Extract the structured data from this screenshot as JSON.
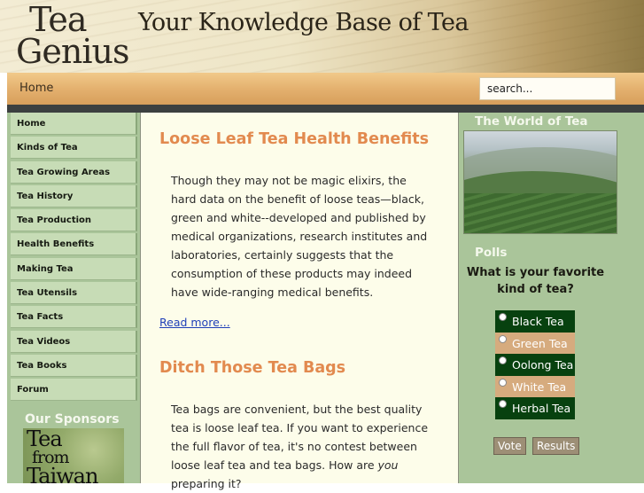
{
  "header": {
    "logo_line1": "Tea",
    "logo_line2": "Genius",
    "tagline": "Your Knowledge Base of Tea"
  },
  "nav": {
    "home_label": "Home",
    "search_value": "search..."
  },
  "sidebar": {
    "items": [
      {
        "label": "Home"
      },
      {
        "label": "Kinds of Tea"
      },
      {
        "label": "Tea Growing Areas"
      },
      {
        "label": "Tea History"
      },
      {
        "label": "Tea Production"
      },
      {
        "label": "Health Benefits"
      },
      {
        "label": "Making Tea"
      },
      {
        "label": "Tea Utensils"
      },
      {
        "label": "Tea Facts"
      },
      {
        "label": "Tea Videos"
      },
      {
        "label": "Tea Books"
      },
      {
        "label": "Forum"
      }
    ],
    "sponsors_title": "Our Sponsors",
    "sponsor_text_1": "Tea",
    "sponsor_text_2": "from",
    "sponsor_text_3": "Taiwan"
  },
  "main": {
    "articles": [
      {
        "title": "Loose Leaf Tea Health Benefits",
        "body": "Though they may not be magic elixirs, the hard data on the benefit of loose teas—black, green and white--developed and published by medical organizations, research institutes and laboratories, certainly suggests that the consumption of these products may indeed have wide-ranging medical benefits."
      },
      {
        "title": "Ditch Those Tea Bags",
        "body_before": "Tea bags are convenient, but the best quality tea is loose leaf tea. If you want to experience the full flavor of tea, it's no contest between loose leaf tea and tea bags. How are ",
        "body_em": "you",
        "body_after": " preparing it?"
      }
    ],
    "read_more": "Read more..."
  },
  "right": {
    "world_title": "The World of Tea",
    "polls_title": "Polls",
    "poll_question": "What is your favorite kind of tea?",
    "poll_options": [
      {
        "label": "Black Tea"
      },
      {
        "label": "Green Tea"
      },
      {
        "label": "Oolong Tea"
      },
      {
        "label": "White Tea"
      },
      {
        "label": "Herbal Tea"
      }
    ],
    "vote_label": "Vote",
    "results_label": "Results"
  },
  "colors": {
    "sidebar_green": "#aac59a",
    "menu_item": "#c7dcb6",
    "article_title": "#e28a4f",
    "poll_dark": "#07410f",
    "poll_light": "#d6ab7e",
    "nav_orange": "#e4b16f"
  }
}
